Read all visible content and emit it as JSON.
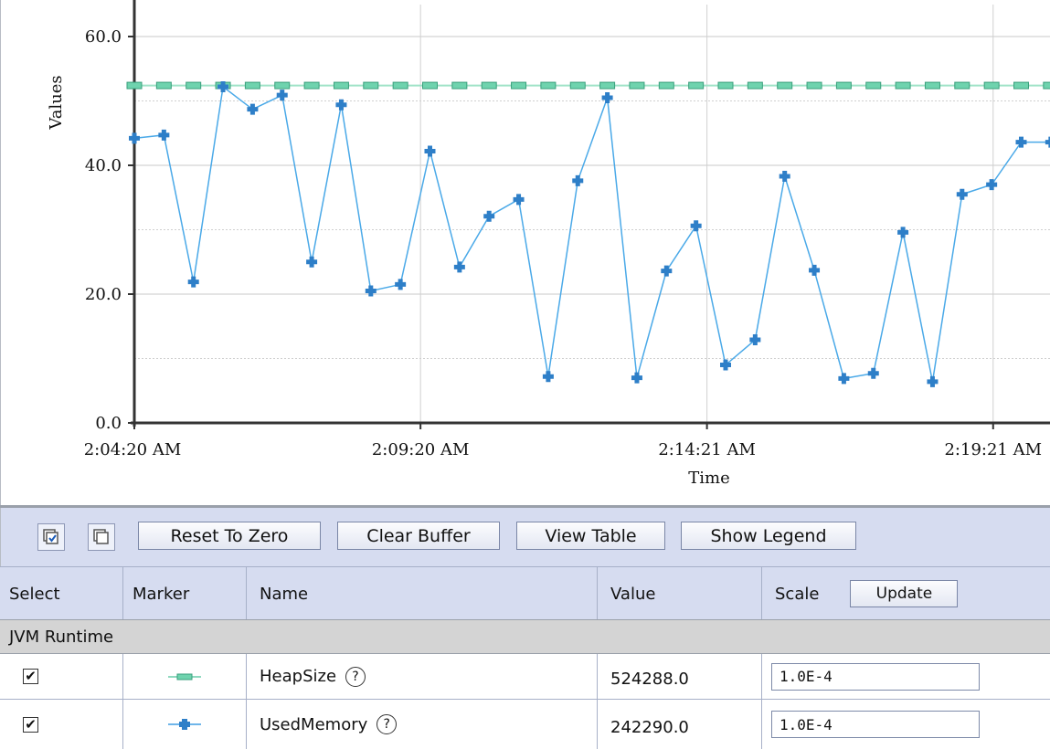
{
  "chart_data": {
    "type": "line",
    "xlabel": "Time",
    "ylabel": "Values",
    "ylim": [
      0,
      60
    ],
    "y_ticks": [
      "0.0",
      "20.0",
      "40.0",
      "60.0"
    ],
    "x_ticks": [
      "2:04:20 AM",
      "2:09:20 AM",
      "2:14:21 AM",
      "2:19:21 AM"
    ],
    "series": [
      {
        "name": "HeapSize",
        "color": "#3cb38b",
        "marker": "dash",
        "values": [
          52.4,
          52.4,
          52.4,
          52.4,
          52.4,
          52.4,
          52.4,
          52.4,
          52.4,
          52.4,
          52.4,
          52.4,
          52.4,
          52.4,
          52.4,
          52.4,
          52.4,
          52.4,
          52.4,
          52.4,
          52.4,
          52.4,
          52.4,
          52.4,
          52.4,
          52.4,
          52.4,
          52.4,
          52.4,
          52.4,
          52.4,
          52.4
        ]
      },
      {
        "name": "UsedMemory",
        "color": "#2e8fd6",
        "marker": "plus",
        "values": [
          44.2,
          44.7,
          21.9,
          52.2,
          48.7,
          50.9,
          25.0,
          49.4,
          20.5,
          21.5,
          42.2,
          24.2,
          32.1,
          34.7,
          7.2,
          37.6,
          50.5,
          7.0,
          23.6,
          30.6,
          9.0,
          12.9,
          38.3,
          23.7,
          6.9,
          7.7,
          29.6,
          6.4,
          35.5,
          37.0,
          43.6,
          43.6
        ]
      }
    ],
    "grid": true,
    "legend": "none"
  },
  "toolbar": {
    "reset_label": "Reset To Zero",
    "clear_label": "Clear Buffer",
    "view_table_label": "View Table",
    "show_legend_label": "Show Legend",
    "select_all_icon": "select-all-icon",
    "deselect_all_icon": "deselect-all-icon"
  },
  "table": {
    "headers": {
      "select": "Select",
      "marker": "Marker",
      "name": "Name",
      "value": "Value",
      "scale": "Scale",
      "update": "Update"
    },
    "group": "JVM Runtime",
    "rows": [
      {
        "checked": true,
        "marker": "dash",
        "name": "HeapSize",
        "help": "?",
        "value": "524288.0",
        "scale": "1.0E-4"
      },
      {
        "checked": true,
        "marker": "plus",
        "name": "UsedMemory",
        "help": "?",
        "value": "242290.0",
        "scale": "1.0E-4"
      }
    ]
  }
}
